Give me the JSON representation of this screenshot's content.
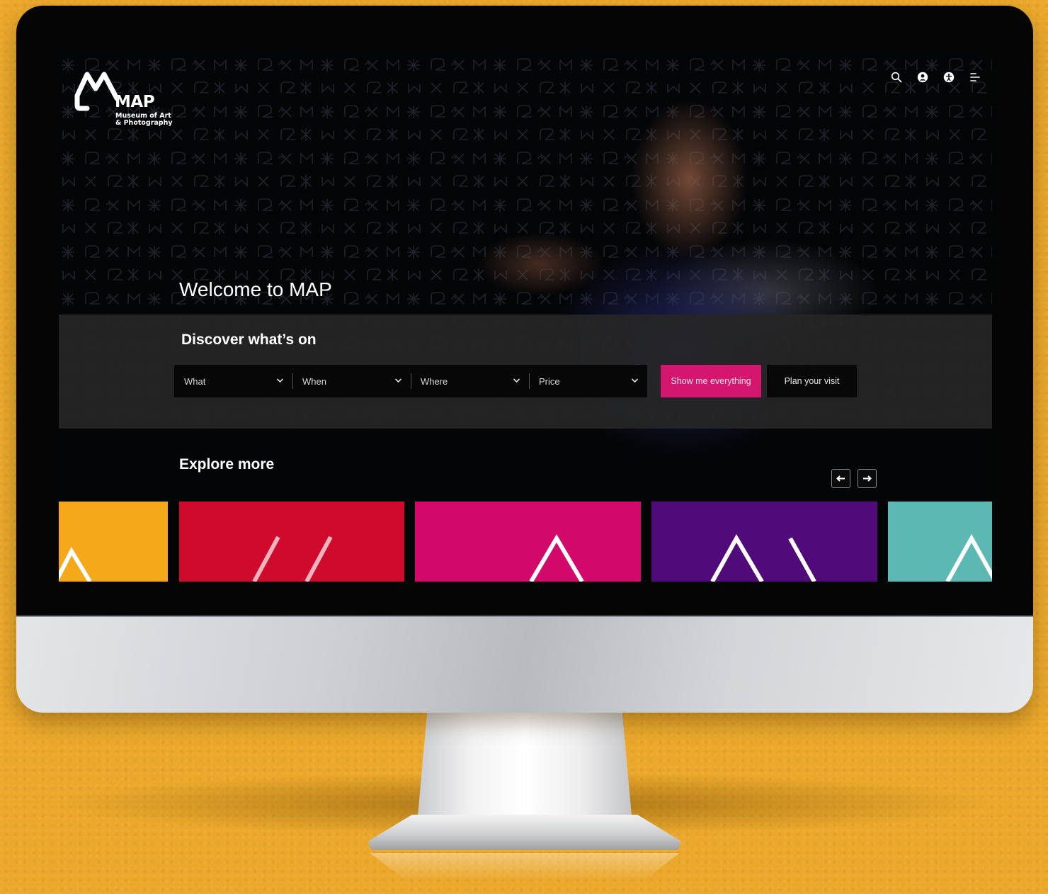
{
  "site": {
    "logo_title": "MAP",
    "logo_subtitle_line1": "Museum of Art",
    "logo_subtitle_line2": "& Photography"
  },
  "header_icons": [
    "search-icon",
    "user-icon",
    "accessibility-icon",
    "menu-icon"
  ],
  "hero": {
    "title": "Welcome to MAP"
  },
  "discover": {
    "title": "Discover what’s on",
    "filters": [
      {
        "label": "What"
      },
      {
        "label": "When"
      },
      {
        "label": "Where"
      },
      {
        "label": "Price"
      }
    ],
    "primary_button": "Show me everything",
    "secondary_button": "Plan your visit"
  },
  "explore": {
    "title": "Explore more",
    "cards": [
      {
        "color": "#f6a81b"
      },
      {
        "color": "#cf0a2c"
      },
      {
        "color": "#d2096b"
      },
      {
        "color": "#500a7a"
      },
      {
        "color": "#5cb8b2"
      }
    ]
  },
  "colors": {
    "accent_pink": "#d4166f",
    "background_orange": "#eba82a"
  }
}
